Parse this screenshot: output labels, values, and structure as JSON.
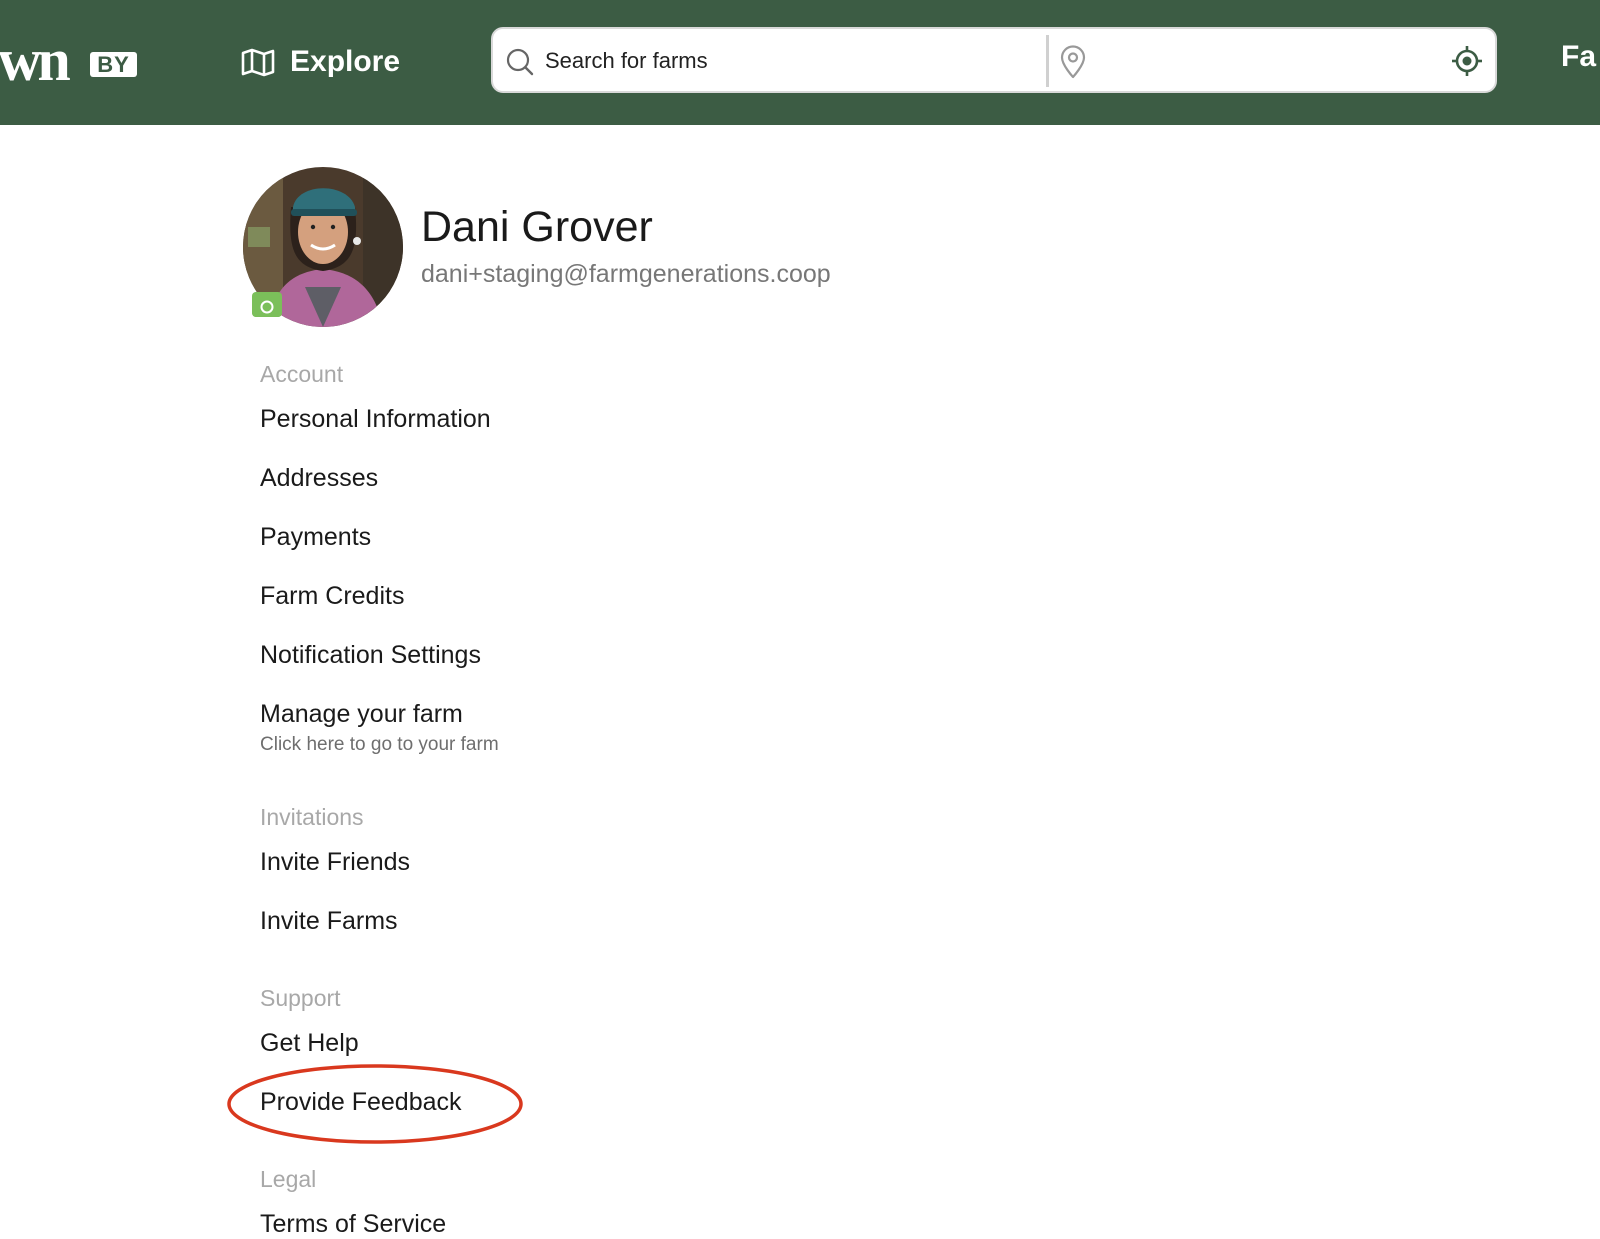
{
  "header": {
    "logo_text": "wn",
    "logo_badge": "BY",
    "explore_label": "Explore",
    "search_placeholder": "Search for farms",
    "location_placeholder": "",
    "farms_link_label": "Fa"
  },
  "profile": {
    "name": "Dani Grover",
    "email": "dani+staging@farmgenerations.coop"
  },
  "sections": {
    "account": {
      "heading": "Account",
      "items": {
        "personal_information": "Personal Information",
        "addresses": "Addresses",
        "payments": "Payments",
        "farm_credits": "Farm Credits",
        "notification_settings": "Notification Settings",
        "manage_farm": "Manage your farm",
        "manage_farm_sub": "Click here to go to your farm"
      }
    },
    "invitations": {
      "heading": "Invitations",
      "items": {
        "invite_friends": "Invite Friends",
        "invite_farms": "Invite Farms"
      }
    },
    "support": {
      "heading": "Support",
      "items": {
        "get_help": "Get Help",
        "provide_feedback": "Provide Feedback"
      }
    },
    "legal": {
      "heading": "Legal",
      "items": {
        "terms_of_service": "Terms of Service"
      }
    }
  },
  "colors": {
    "header_bg": "#3c5c44",
    "annotation": "#d9381e",
    "badge": "#7bbf5a"
  },
  "icons": {
    "explore": "map-icon",
    "search": "search-icon",
    "location": "location-pin-icon",
    "locate": "crosshair-icon",
    "avatar_badge": "camera-icon"
  }
}
